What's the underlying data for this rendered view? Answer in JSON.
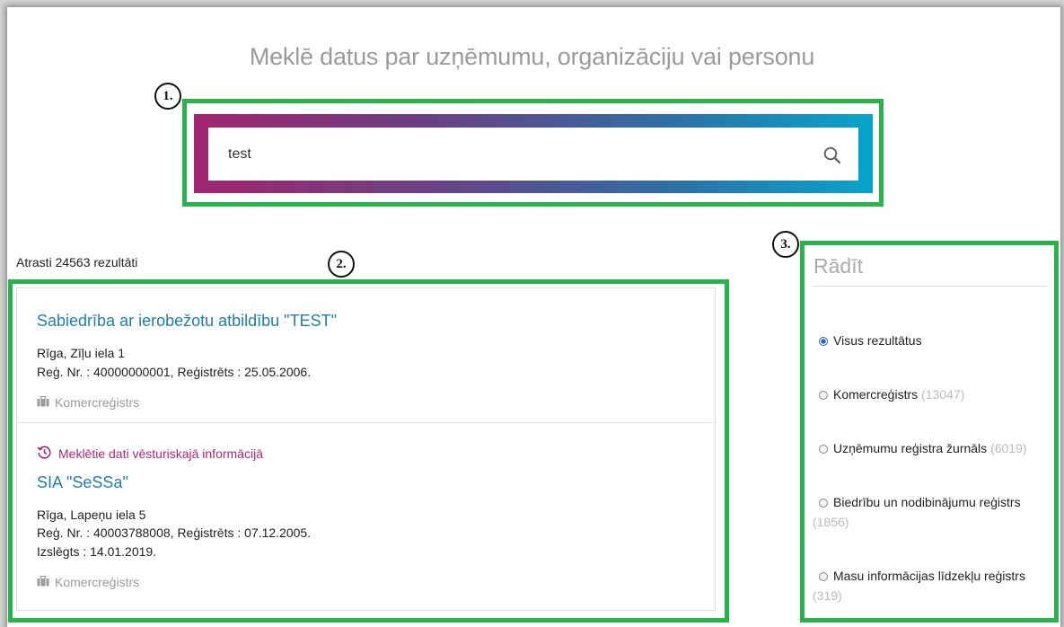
{
  "header": {
    "title": "Meklē datus par uzņēmumu, organizāciju vai personu"
  },
  "markers": [
    "1.",
    "2.",
    "3."
  ],
  "search": {
    "value": "test",
    "placeholder": ""
  },
  "results": {
    "count_text": "Atrasti 24563 rezultāti",
    "items": [
      {
        "title": "Sabiedrība ar ierobežotu atbildību \"TEST\"",
        "address": "Rīga, Zīļu iela 1",
        "reg_line": "Reģ. Nr. : 40000000001, Reģistrēts : 25.05.2006.",
        "register": "Komercreģistrs"
      },
      {
        "history_note": "Meklētie dati vēsturiskajā informācijā",
        "title": "SIA \"SeSSa\"",
        "address": "Rīga, Lapeņu iela 5",
        "reg_line": "Reģ. Nr. : 40003788008, Reģistrēts : 07.12.2005.",
        "excluded_line": "Izslēgts : 14.01.2019.",
        "register": "Komercreģistrs"
      }
    ]
  },
  "filter": {
    "title": "Rādīt",
    "options": [
      {
        "label": "Visus rezultātus",
        "count": "",
        "selected": true
      },
      {
        "label": "Komercreģistrs",
        "count": "(13047)",
        "selected": false
      },
      {
        "label": "Uzņēmumu reģistra žurnāls",
        "count": "(6019)",
        "selected": false
      },
      {
        "label": "Biedrību un nodibinājumu reģistrs",
        "count": "(1856)",
        "selected": false
      },
      {
        "label": "Masu informācijas līdzekļu reģistrs",
        "count": "(319)",
        "selected": false
      }
    ]
  },
  "colors": {
    "annotation": "#2ab34b",
    "link": "#1f7fa8",
    "history": "#a62a74"
  }
}
